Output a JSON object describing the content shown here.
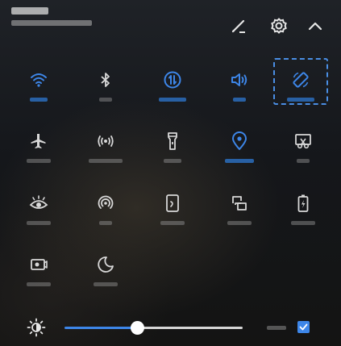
{
  "header": {
    "edit_icon": "pencil-icon",
    "settings_icon": "gear-icon",
    "collapse_icon": "chevron-up-icon"
  },
  "colors": {
    "accent": "#3d86e8",
    "icon_off": "#d8d8d8"
  },
  "tiles": [
    {
      "icon": "wifi-icon",
      "active": true
    },
    {
      "icon": "bluetooth-icon",
      "active": false
    },
    {
      "icon": "mobile-data-icon",
      "active": true
    },
    {
      "icon": "sound-icon",
      "active": true
    },
    {
      "icon": "auto-rotate-icon",
      "active": true,
      "highlighted": true
    },
    {
      "icon": "airplane-mode-icon",
      "active": false
    },
    {
      "icon": "hotspot-icon",
      "active": false
    },
    {
      "icon": "flashlight-icon",
      "active": false
    },
    {
      "icon": "location-icon",
      "active": true
    },
    {
      "icon": "screenshot-icon",
      "active": false
    },
    {
      "icon": "eye-comfort-icon",
      "active": false
    },
    {
      "icon": "nfc-icon",
      "active": false
    },
    {
      "icon": "screen-cast-icon",
      "active": false
    },
    {
      "icon": "multi-screen-icon",
      "active": false
    },
    {
      "icon": "battery-saver-icon",
      "active": false
    },
    {
      "icon": "screen-record-icon",
      "active": false
    },
    {
      "icon": "do-not-disturb-icon",
      "active": false
    }
  ],
  "brightness": {
    "icon": "brightness-icon",
    "level": 0.33,
    "auto_checked": true
  }
}
